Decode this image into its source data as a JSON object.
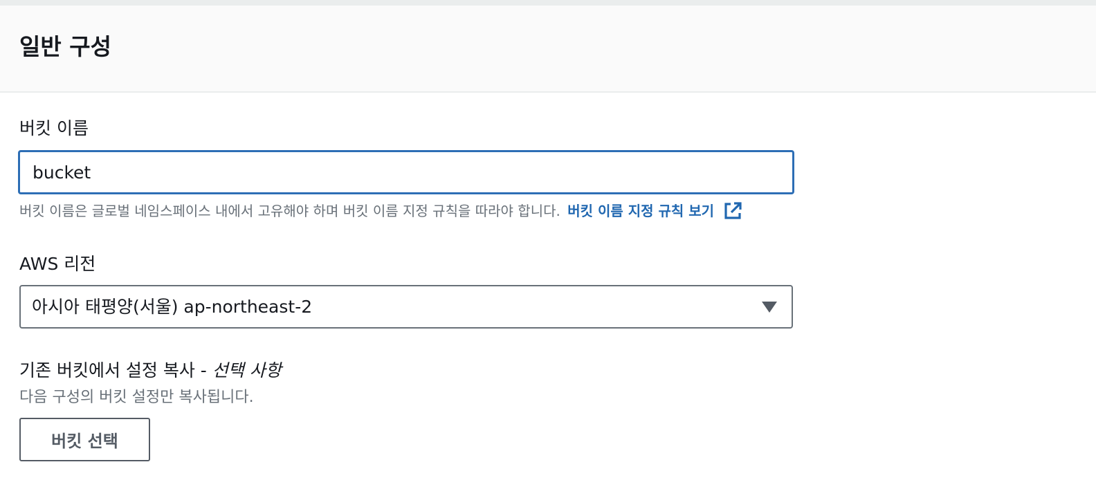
{
  "section": {
    "title": "일반 구성"
  },
  "bucket_name": {
    "label": "버킷 이름",
    "value": "bucket",
    "hint": "버킷 이름은 글로벌 네임스페이스 내에서 고유해야 하며 버킷 이름 지정 규칙을 따라야 합니다.",
    "link_label": "버킷 이름 지정 규칙 보기",
    "link_icon": "external-link-icon"
  },
  "region": {
    "label": "AWS 리전",
    "selected": "아시아 태평양(서울) ap-northeast-2",
    "icon": "caret-down-icon"
  },
  "copy_settings": {
    "label": "기존 버킷에서 설정 복사 - ",
    "optional": "선택 사항",
    "description": "다음 구성의 버킷 설정만 복사됩니다.",
    "button_label": "버킷 선택"
  },
  "colors": {
    "accent": "#2067b0",
    "focus_border": "#2d6eb5",
    "text": "#16191f",
    "muted": "#687078",
    "header_bg": "#fafafa"
  }
}
